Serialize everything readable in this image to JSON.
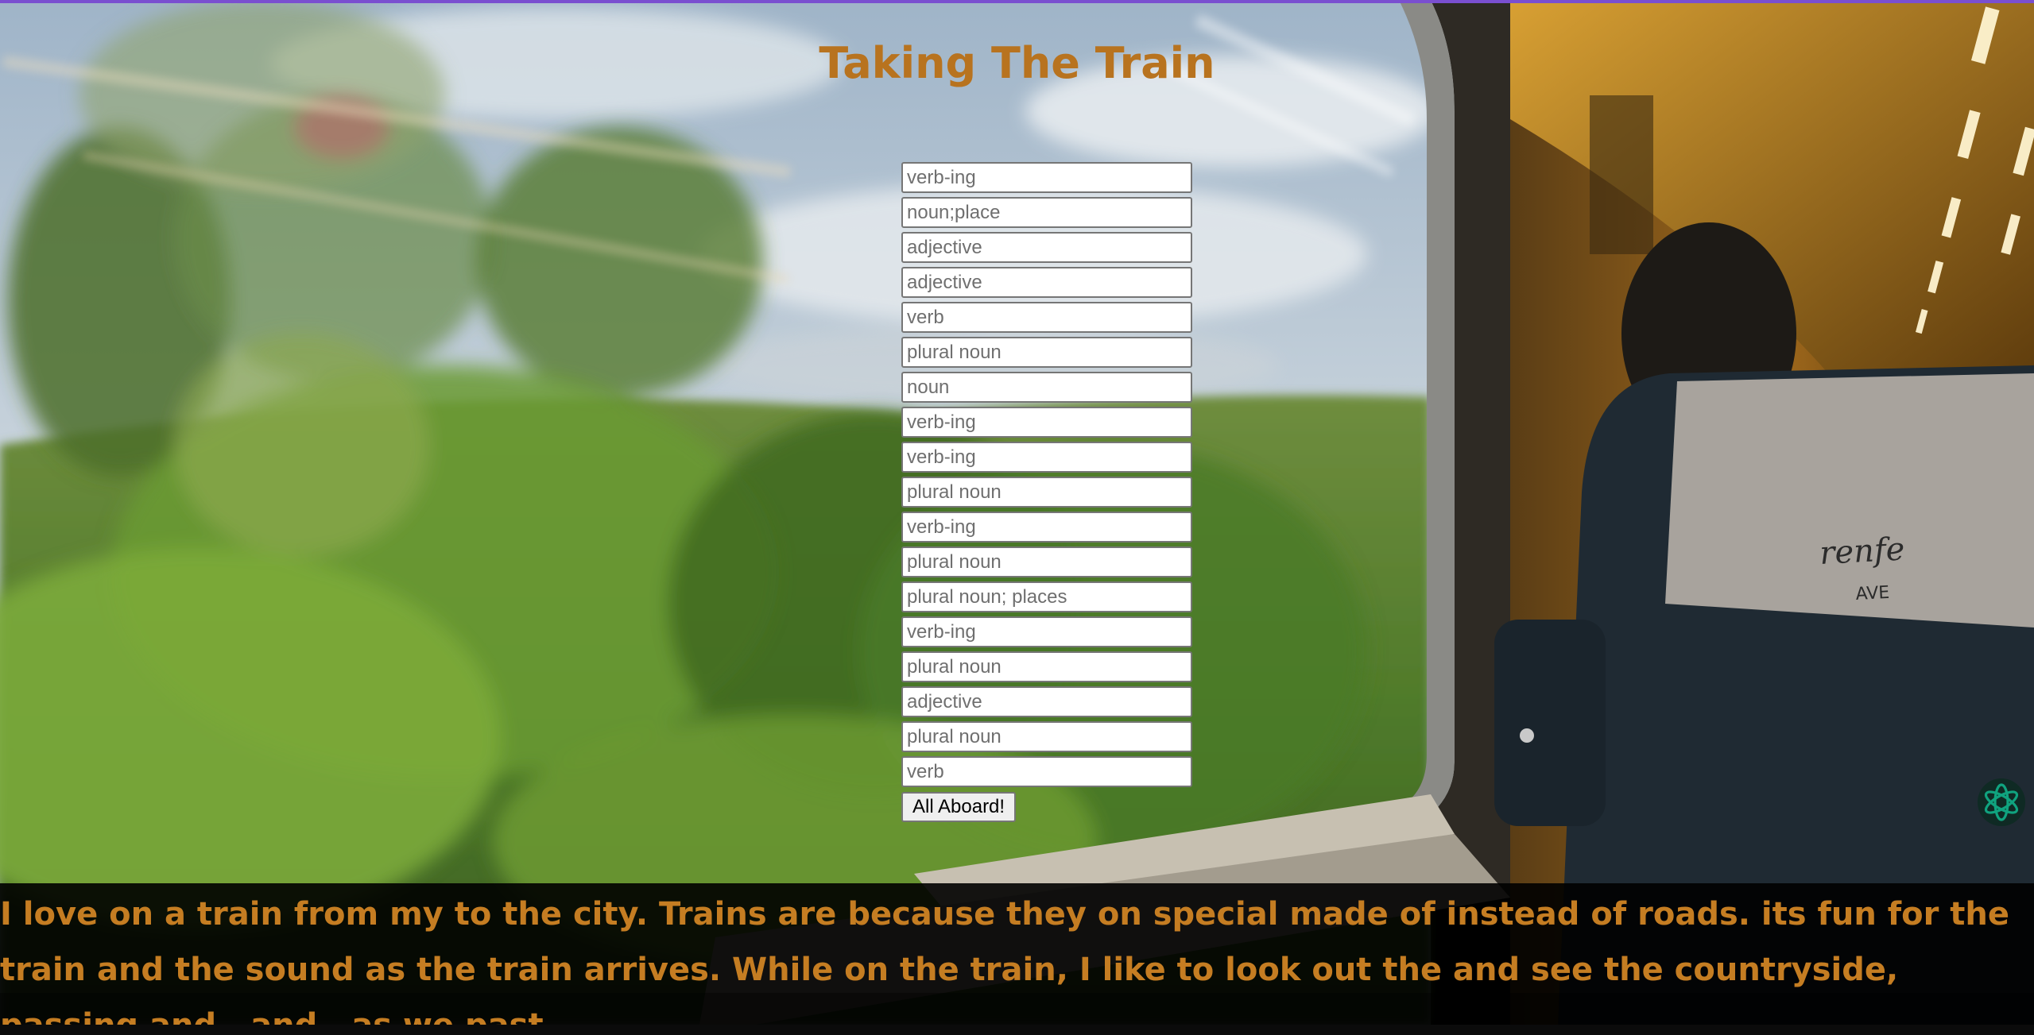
{
  "page": {
    "title": "Taking The Train"
  },
  "form": {
    "fields": [
      {
        "placeholder": "verb-ing",
        "value": ""
      },
      {
        "placeholder": "noun;place",
        "value": ""
      },
      {
        "placeholder": "adjective",
        "value": ""
      },
      {
        "placeholder": "adjective",
        "value": ""
      },
      {
        "placeholder": "verb",
        "value": ""
      },
      {
        "placeholder": "plural noun",
        "value": ""
      },
      {
        "placeholder": "noun",
        "value": ""
      },
      {
        "placeholder": "verb-ing",
        "value": ""
      },
      {
        "placeholder": "verb-ing",
        "value": ""
      },
      {
        "placeholder": "plural noun",
        "value": ""
      },
      {
        "placeholder": "verb-ing",
        "value": ""
      },
      {
        "placeholder": "plural noun",
        "value": ""
      },
      {
        "placeholder": "plural noun; places",
        "value": ""
      },
      {
        "placeholder": "verb-ing",
        "value": ""
      },
      {
        "placeholder": "plural noun",
        "value": ""
      },
      {
        "placeholder": "adjective",
        "value": ""
      },
      {
        "placeholder": "plural noun",
        "value": ""
      },
      {
        "placeholder": "verb",
        "value": ""
      }
    ],
    "submit_label": "All Aboard!"
  },
  "story": {
    "text": "I love on a train from my to the city. Trains are because they on special made of instead of roads. its fun for the train and the sound as the train arrives. While on the train, I like to look out the and see the countryside, passing and , and . as we past."
  },
  "background": {
    "carriage_brand": "renfe",
    "carriage_sub": "AVE"
  },
  "colors": {
    "title": "#b8731f",
    "story_text": "#c57d22",
    "story_background": "#000000",
    "top_line": "#7a4fd0",
    "assistant_icon": "#10a37f"
  },
  "icons": {
    "assistant": "openai-knot-icon"
  }
}
